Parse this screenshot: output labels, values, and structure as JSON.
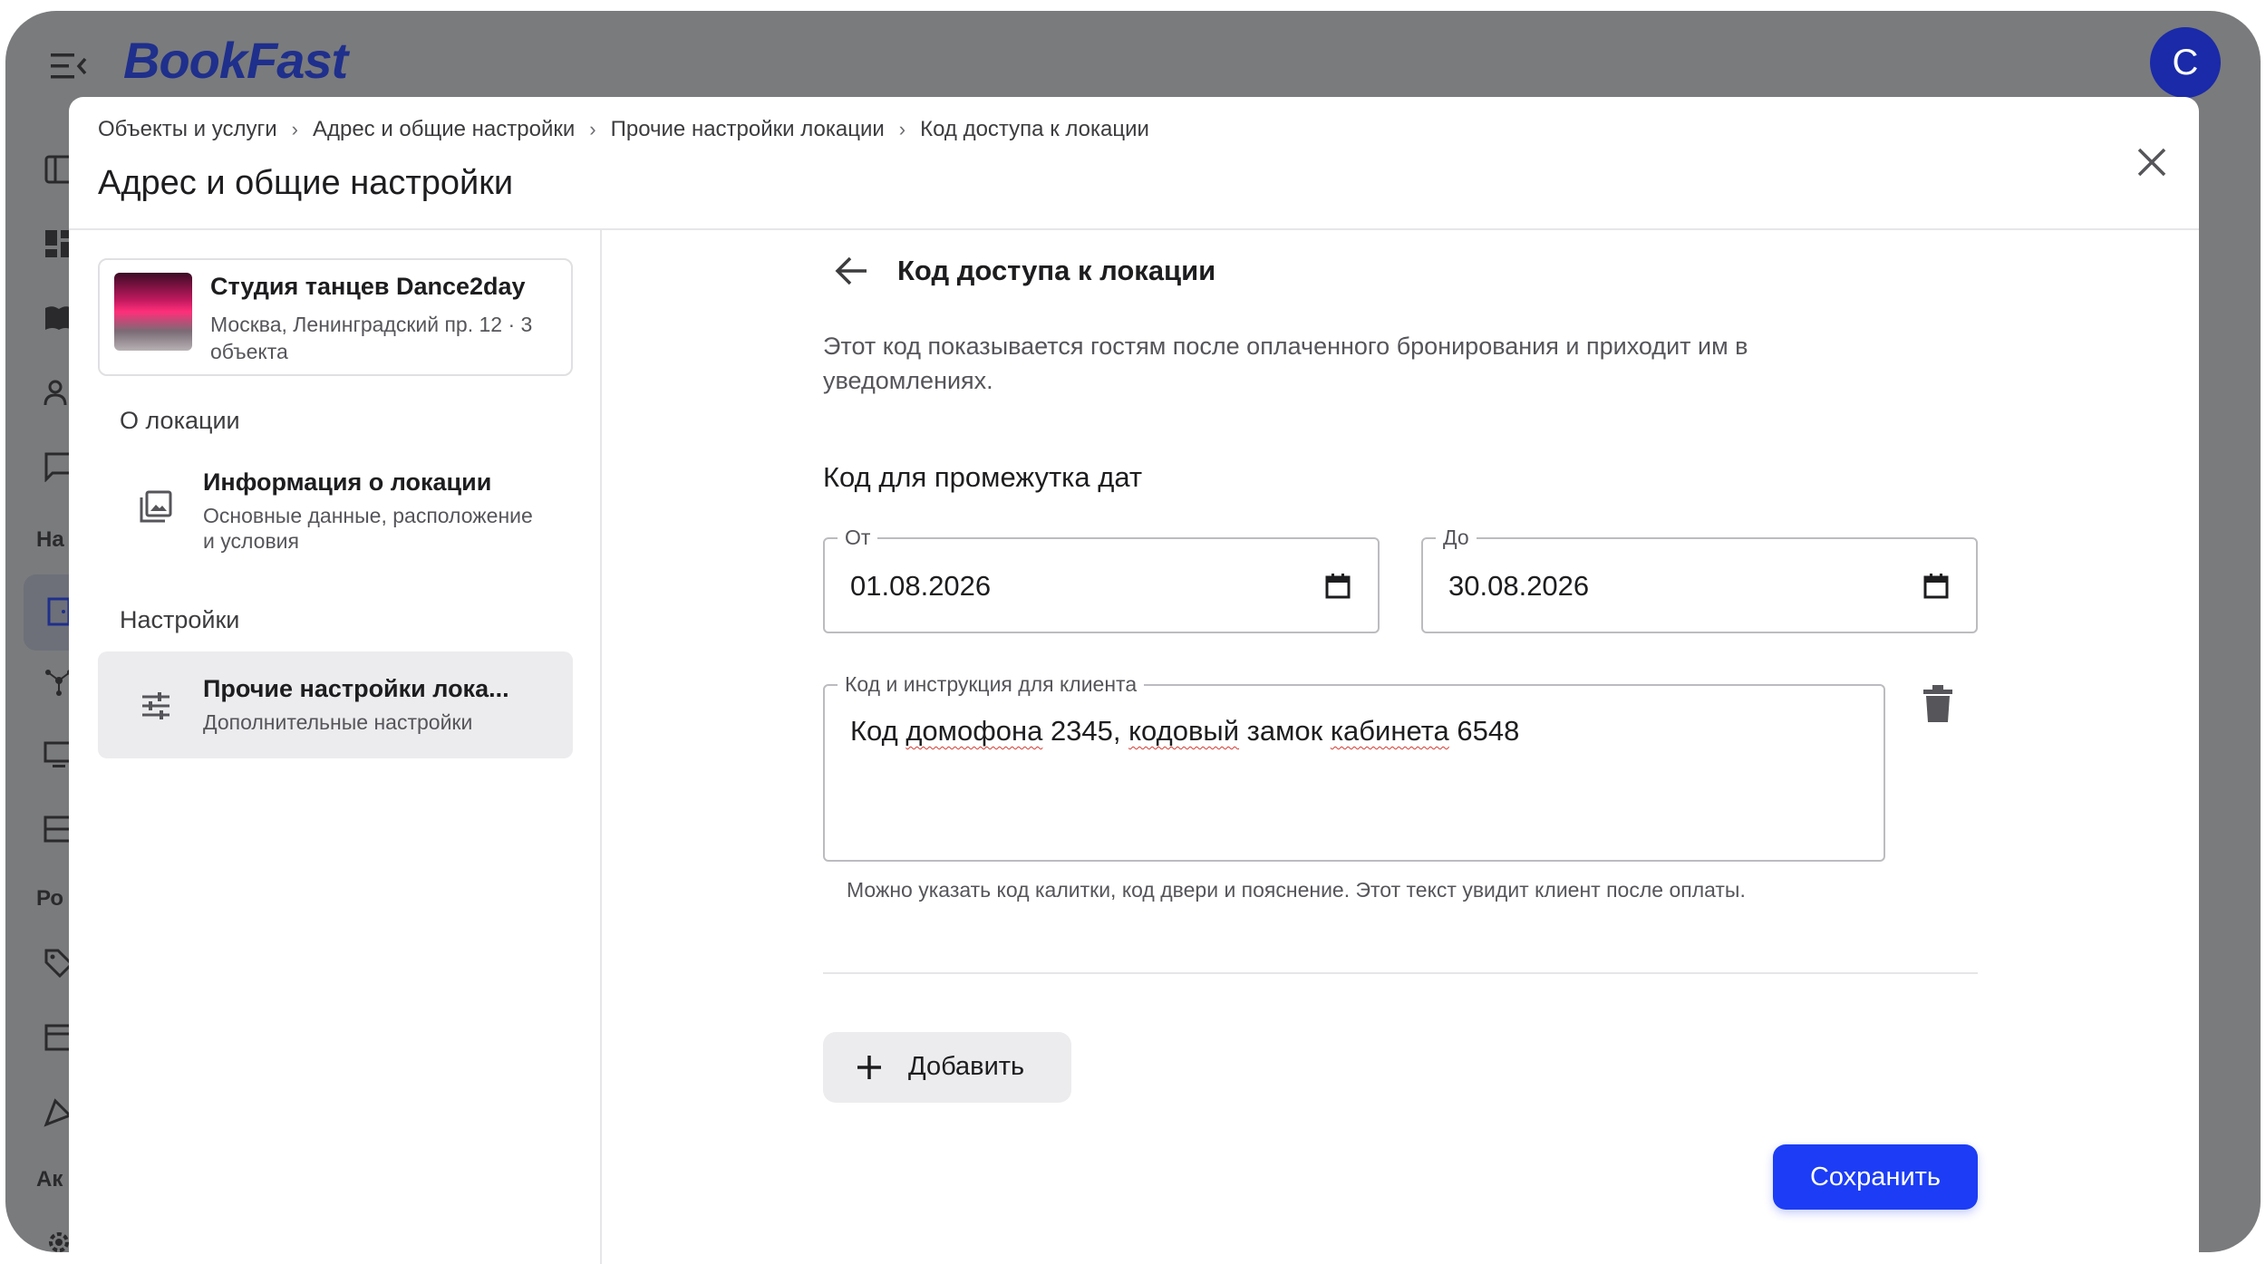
{
  "app": {
    "logo": "BookFast",
    "avatar_letter": "С",
    "rail_texts": [
      "На",
      "Ро",
      "Ак"
    ]
  },
  "breadcrumb": [
    "Объекты и услуги",
    "Адрес и общие настройки",
    "Прочие настройки локации",
    "Код доступа к локации"
  ],
  "modal": {
    "title": "Адрес и общие настройки"
  },
  "location": {
    "name": "Студия танцев Dance2day",
    "address": "Москва, Ленинградский пр. 12 · 3 объекта"
  },
  "sidebar": {
    "section_about": "О локации",
    "info_item": {
      "title": "Информация о локации",
      "subtitle": "Основные данные, расположение и условия"
    },
    "section_settings": "Настройки",
    "other_item": {
      "title": "Прочие настройки лока...",
      "subtitle": "Дополнительные настройки"
    }
  },
  "content": {
    "title": "Код доступа к локации",
    "description": "Этот код показывается гостям после оплаченного бронирования и приходит им в уведомлениях.",
    "section_title": "Код для промежутка дат",
    "from": {
      "label": "От",
      "value": "01.08.2026"
    },
    "to": {
      "label": "До",
      "value": "30.08.2026"
    },
    "code": {
      "label": "Код и инструкция для клиента",
      "parts": [
        "Код ",
        "домофона",
        " 2345, ",
        "кодовый",
        " замок ",
        "кабинета",
        " 6548"
      ]
    },
    "helper": "Можно указать код калитки, код двери и пояснение. Этот текст увидит клиент после оплаты.",
    "add_label": "Добавить",
    "save_label": "Сохранить"
  },
  "colors": {
    "accent": "#1c3df5",
    "logo": "#1f2f8c",
    "overlay": "#7a7b7d"
  }
}
